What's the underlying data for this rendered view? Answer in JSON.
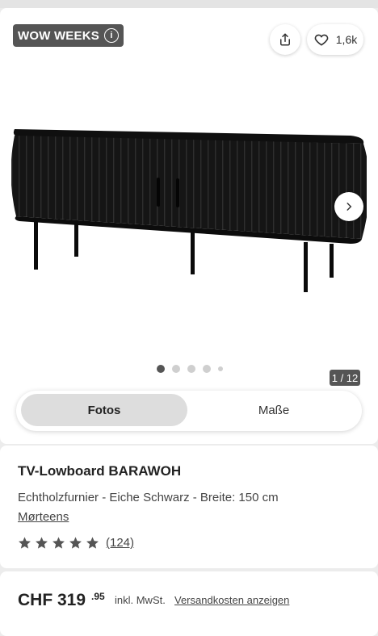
{
  "gallery": {
    "badge_label": "WOW WEEKS",
    "info_icon_glyph": "i",
    "like_count": "1,6k",
    "image_counter": "1 / 12",
    "dots_total": 5,
    "dots_active_index": 0,
    "view_toggle": {
      "options": [
        "Fotos",
        "Maße"
      ],
      "selected": "Fotos"
    }
  },
  "product": {
    "title": "TV-Lowboard BARAWOH",
    "subtitle": "Echtholzfurnier - Eiche Schwarz - Breite: 150 cm",
    "brand": "Mørteens",
    "rating_stars": 5,
    "review_count": "(124)"
  },
  "price": {
    "main": "CHF 319",
    "cents": ".95",
    "vat_note": "inkl. MwSt.",
    "shipping_link": "Versandkosten anzeigen"
  },
  "colors": {
    "badge_bg": "#555555",
    "toggle_selected_bg": "#dddddd",
    "page_bg": "#ececec",
    "product_color": "#111111"
  },
  "icons": {
    "share": "share-icon",
    "like": "heart-icon",
    "next": "chevron-right-icon",
    "info": "info-icon",
    "star": "star-icon"
  }
}
